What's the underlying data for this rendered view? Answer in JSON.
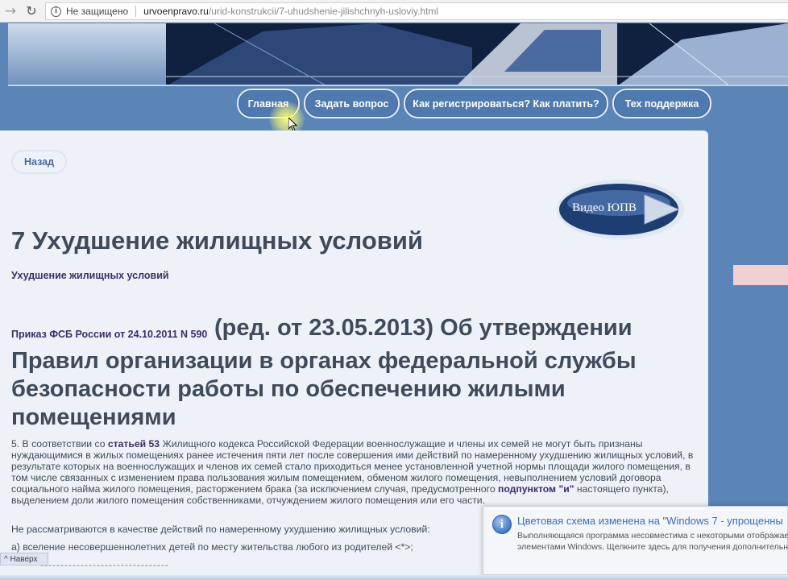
{
  "browser": {
    "secure_label": "Не защищено",
    "url_host": "urvoenpravo.ru",
    "url_path": "/urid-konstrukcii/7-uhudshenie-jilishchnyh-usloviy.html",
    "back_icon": "arrow-right-icon",
    "reload_icon": "reload-icon"
  },
  "topnav": {
    "items": [
      {
        "label": "Главная"
      },
      {
        "label": "Задать вопрос"
      },
      {
        "label": "Как регистрироваться? Как платить?"
      },
      {
        "label": "Тех поддержка"
      }
    ]
  },
  "content": {
    "back_label": "Назад",
    "video_label": "Видео ЮПВ",
    "title": "7 Ухудшение жилищных условий",
    "subtitle": "Ухудшение жилищных условий",
    "order_link": "Приказ ФСБ России от 24.10.2011 N 590",
    "order_rest": "(ред. от 23.05.2013) Об утверждении",
    "heading2": "Правил организации в органах федеральной службы безопасности работы по обеспечению жилыми помещениями",
    "para1_a": "5. В соответствии со ",
    "para1_link1": "статьей 53",
    "para1_b": " Жилищного кодекса Российской Федерации военнослужащие и члены их семей не могут быть признаны нуждающимися в жилых помещениях ранее истечения пяти лет после совершения ими действий по намеренному ухудшению жилищных условий, в результате которых на военнослужащих и членов их семей стало приходиться менее установленной учетной нормы площади жилого помещения, в том числе связанных с изменением права пользования жилым помещением, обменом жилого помещения, невыполнением условий договора социального найма жилого помещения, расторжением брака (за исключением случая, предусмотренного ",
    "para1_link2": "подпунктом \"и\"",
    "para1_c": " настоящего пункта), выделением доли жилого помещения собственниками, отчуждением жилого помещения или его части.",
    "para2": "Не рассматриваются в качестве действий по намеренному ухудшению жилищных условий:",
    "para3": "а) вселение несовершеннолетних детей по месту жительства любого из родителей <*>;",
    "dashes": "--------------------------------",
    "up_label": "^ Наверх"
  },
  "toast": {
    "title": "Цветовая схема изменена на \"Windows 7 - упрощенны",
    "line1": "Выполняющаяся программа несовместима с некоторыми отображае",
    "line2": "элементами Windows.  Щелкните здесь для получения дополнительны",
    "icon": "info-icon"
  },
  "colors": {
    "background": "#5b85b6",
    "panel": "#eef2f8",
    "text": "#3f4b5b",
    "link": "#3b2d6b",
    "pink_strip": "#f1cfd4"
  }
}
